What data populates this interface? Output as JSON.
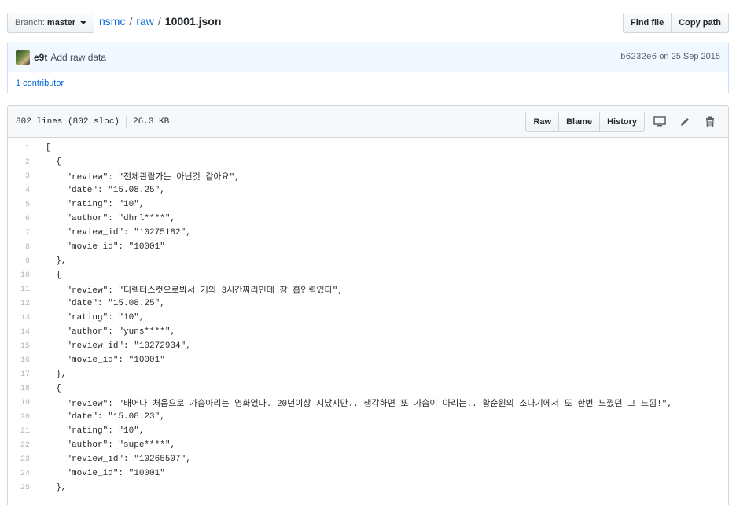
{
  "branch": {
    "label": "Branch:",
    "value": "master"
  },
  "breadcrumb": {
    "repo": "nsmc",
    "sep1": "/",
    "dir": "raw",
    "sep2": "/",
    "file": "10001.json"
  },
  "top_actions": {
    "find_file": "Find file",
    "copy_path": "Copy path"
  },
  "commit": {
    "author": "e9t",
    "message": "Add raw data",
    "sha": "b6232e6",
    "date_text": "on 25 Sep 2015",
    "contributors": "1 contributor"
  },
  "file": {
    "lines_info": "802 lines (802 sloc)",
    "size": "26.3 KB",
    "buttons": {
      "raw": "Raw",
      "blame": "Blame",
      "history": "History"
    },
    "icons": [
      "desktop-icon",
      "pencil-icon",
      "trash-icon"
    ]
  },
  "code_lines": [
    {
      "n": "1",
      "text": "["
    },
    {
      "n": "2",
      "text": "  {"
    },
    {
      "n": "3",
      "text": "    \"review\": \"전체관람가는 아닌것 같아요\","
    },
    {
      "n": "4",
      "text": "    \"date\": \"15.08.25\","
    },
    {
      "n": "5",
      "text": "    \"rating\": \"10\","
    },
    {
      "n": "6",
      "text": "    \"author\": \"dhrl****\","
    },
    {
      "n": "7",
      "text": "    \"review_id\": \"10275182\","
    },
    {
      "n": "8",
      "text": "    \"movie_id\": \"10001\""
    },
    {
      "n": "9",
      "text": "  },"
    },
    {
      "n": "10",
      "text": "  {"
    },
    {
      "n": "11",
      "text": "    \"review\": \"디렉터스컷으로봐서 거의 3시간짜리인데 참 흡인력있다\","
    },
    {
      "n": "12",
      "text": "    \"date\": \"15.08.25\","
    },
    {
      "n": "13",
      "text": "    \"rating\": \"10\","
    },
    {
      "n": "14",
      "text": "    \"author\": \"yuns****\","
    },
    {
      "n": "15",
      "text": "    \"review_id\": \"10272934\","
    },
    {
      "n": "16",
      "text": "    \"movie_id\": \"10001\""
    },
    {
      "n": "17",
      "text": "  },"
    },
    {
      "n": "18",
      "text": "  {"
    },
    {
      "n": "19",
      "text": "    \"review\": \"태어나 처음으로 가슴아리는 영화였다. 20년이상 지났지만.. 생각하면 또 가슴이 아리는.. 황순원의 소나기에서 또 한번 느꼈던 그 느낌!\","
    },
    {
      "n": "20",
      "text": "    \"date\": \"15.08.23\","
    },
    {
      "n": "21",
      "text": "    \"rating\": \"10\","
    },
    {
      "n": "22",
      "text": "    \"author\": \"supe****\","
    },
    {
      "n": "23",
      "text": "    \"review_id\": \"10265507\","
    },
    {
      "n": "24",
      "text": "    \"movie_id\": \"10001\""
    },
    {
      "n": "25",
      "text": "  },"
    }
  ],
  "colors": {
    "link": "#0366d6",
    "commit_bg": "#f1f8ff",
    "commit_border": "#c8e1ff",
    "code_string": "#032f62"
  }
}
